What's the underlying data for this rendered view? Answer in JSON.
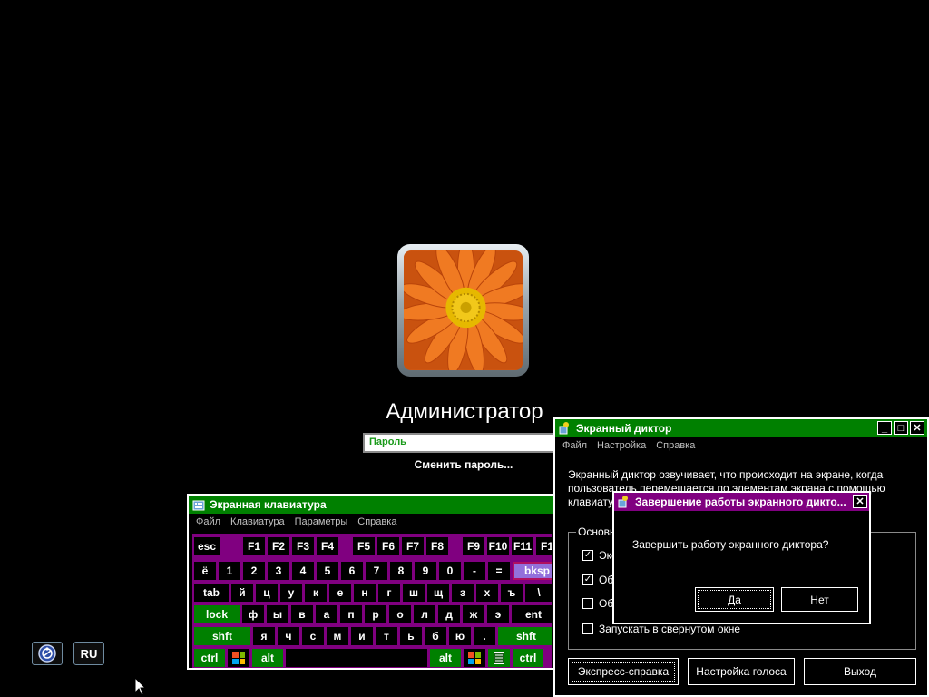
{
  "login": {
    "user_name": "Администратор",
    "password_placeholder": "Пароль",
    "change_password": "Сменить пароль..."
  },
  "bottom": {
    "language": "RU"
  },
  "keyboard": {
    "title": "Экранная клавиатура",
    "menu": [
      "Файл",
      "Клавиатура",
      "Параметры",
      "Справка"
    ],
    "rows": {
      "r1": [
        "esc",
        "F1",
        "F2",
        "F3",
        "F4",
        "F5",
        "F6",
        "F7",
        "F8",
        "F9",
        "F10",
        "F11",
        "F1"
      ],
      "r2": [
        "ё",
        "1",
        "2",
        "3",
        "4",
        "5",
        "6",
        "7",
        "8",
        "9",
        "0",
        "-",
        "=",
        "bksp"
      ],
      "r3": [
        "tab",
        "й",
        "ц",
        "у",
        "к",
        "е",
        "н",
        "г",
        "ш",
        "щ",
        "з",
        "х",
        "ъ",
        "\\"
      ],
      "r4": [
        "lock",
        "ф",
        "ы",
        "в",
        "а",
        "п",
        "р",
        "о",
        "л",
        "д",
        "ж",
        "э",
        "ent"
      ],
      "r5": [
        "shft",
        "я",
        "ч",
        "с",
        "м",
        "и",
        "т",
        "ь",
        "б",
        "ю",
        ".",
        "shft"
      ],
      "r6": [
        "ctrl",
        "alt",
        "alt",
        "ctrl"
      ]
    }
  },
  "narrator": {
    "title": "Экранный диктор",
    "menu": [
      "Файл",
      "Настройка",
      "Справка"
    ],
    "description": "Экранный диктор озвучивает, что происходит на экране, когда пользователь перемещается по элементам экрана с помощью клавиатуры.",
    "group_label": "Основн",
    "options": [
      "Экс",
      "Обь",
      "Обь",
      "Запускать в свернутом окне"
    ],
    "options_checked": [
      true,
      true,
      false,
      false
    ],
    "buttons": {
      "quick_help": "Экспресс-справка",
      "voice_settings": "Настройка голоса",
      "exit": "Выход"
    }
  },
  "confirm_dialog": {
    "title": "Завершение работы экранного дикто...",
    "question": "Завершить работу экранного диктора?",
    "yes": "Да",
    "no": "Нет"
  }
}
